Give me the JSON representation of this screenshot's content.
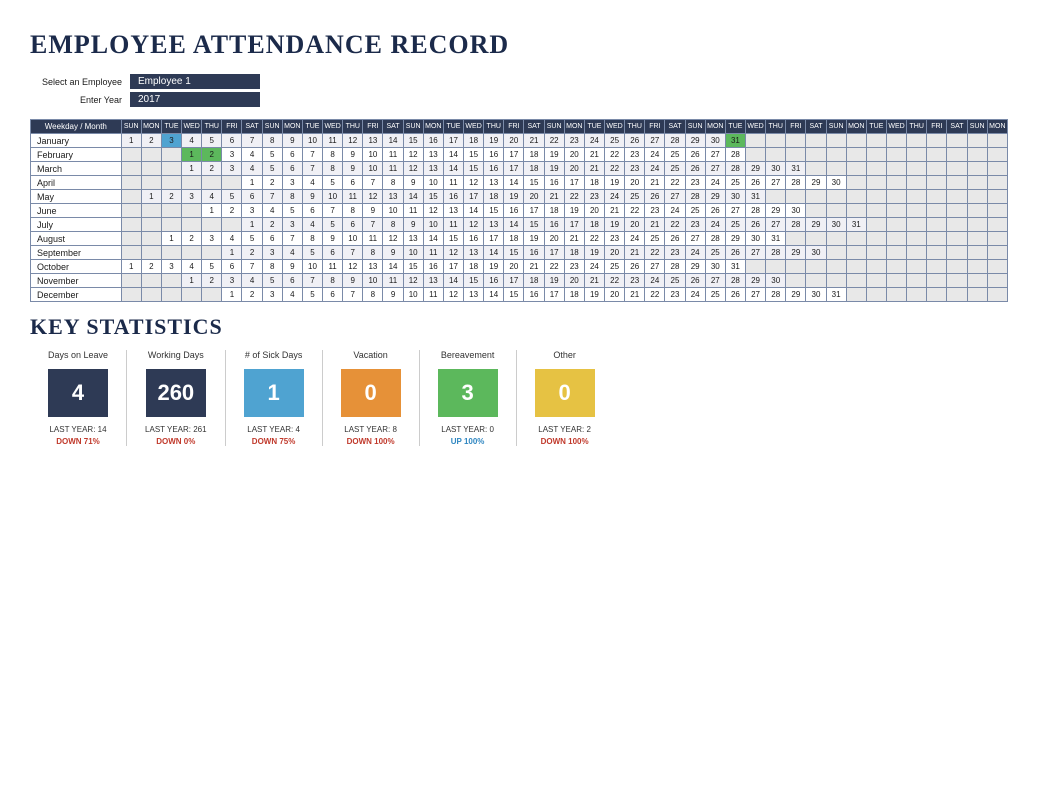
{
  "title": "EMPLOYEE ATTENDANCE RECORD",
  "controls": {
    "employee_label": "Select an Employee",
    "employee_value": "Employee 1",
    "year_label": "Enter Year",
    "year_value": "2017"
  },
  "weekday_header_label": "Weekday / Month",
  "weekdays_cycle": [
    "SUN",
    "MON",
    "TUE",
    "WED",
    "THU",
    "FRI",
    "SAT"
  ],
  "header_cols": 44,
  "months": [
    {
      "name": "January",
      "start": 0,
      "len": 31,
      "marks": {
        "2": "hl-blue",
        "30": "hl-green",
        "31": "hl-green"
      }
    },
    {
      "name": "February",
      "start": 3,
      "len": 28,
      "marks": {
        "0": "hl-green",
        "1": "hl-green"
      }
    },
    {
      "name": "March",
      "start": 3,
      "len": 31,
      "marks": {}
    },
    {
      "name": "April",
      "start": 6,
      "len": 30,
      "marks": {}
    },
    {
      "name": "May",
      "start": 1,
      "len": 31,
      "marks": {}
    },
    {
      "name": "June",
      "start": 4,
      "len": 30,
      "marks": {}
    },
    {
      "name": "July",
      "start": 6,
      "len": 31,
      "marks": {}
    },
    {
      "name": "August",
      "start": 2,
      "len": 31,
      "marks": {}
    },
    {
      "name": "September",
      "start": 5,
      "len": 30,
      "marks": {}
    },
    {
      "name": "October",
      "start": 0,
      "len": 31,
      "marks": {}
    },
    {
      "name": "November",
      "start": 3,
      "len": 30,
      "marks": {}
    },
    {
      "name": "December",
      "start": 5,
      "len": 31,
      "marks": {}
    }
  ],
  "key_title": "KEY STATISTICS",
  "stats": [
    {
      "label": "Days on Leave",
      "value": "4",
      "last": "LAST YEAR: 14",
      "change": "DOWN 71%",
      "dir": "down",
      "color": "#2e3a55"
    },
    {
      "label": "Working Days",
      "value": "260",
      "last": "LAST YEAR: 261",
      "change": "DOWN 0%",
      "dir": "down",
      "color": "#2e3a55"
    },
    {
      "label": "# of Sick Days",
      "value": "1",
      "last": "LAST YEAR: 4",
      "change": "DOWN 75%",
      "dir": "down",
      "color": "#4fa3d1"
    },
    {
      "label": "Vacation",
      "value": "0",
      "last": "LAST YEAR: 8",
      "change": "DOWN 100%",
      "dir": "down",
      "color": "#e69138"
    },
    {
      "label": "Bereavement",
      "value": "3",
      "last": "LAST YEAR: 0",
      "change": "UP 100%",
      "dir": "up",
      "color": "#5cb85c"
    },
    {
      "label": "Other",
      "value": "0",
      "last": "LAST YEAR: 2",
      "change": "DOWN 100%",
      "dir": "down",
      "color": "#e6c243"
    }
  ]
}
